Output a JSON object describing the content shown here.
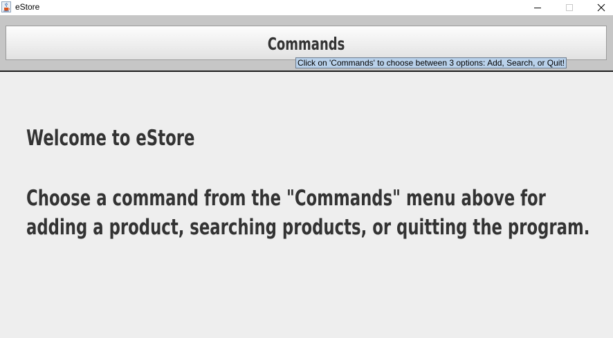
{
  "window": {
    "title": "eStore",
    "icons": {
      "app": "java-cup-icon",
      "minimize": "minimize-icon",
      "maximize": "maximize-icon",
      "close": "close-icon"
    }
  },
  "menubar": {
    "commands_label": "Commands",
    "tooltip": "Click on 'Commands' to choose between 3 options: Add, Search, or Quit!"
  },
  "main": {
    "welcome": "Welcome to eStore",
    "instruction_line1": "Choose a command from the \"Commands\" menu above for",
    "instruction_line2": "adding a product, searching products, or quitting the program."
  },
  "colors": {
    "background": "#eeeeee",
    "menubar_background": "#c6c6c6",
    "text": "#333333",
    "tooltip_background": "#b9d1ea"
  }
}
